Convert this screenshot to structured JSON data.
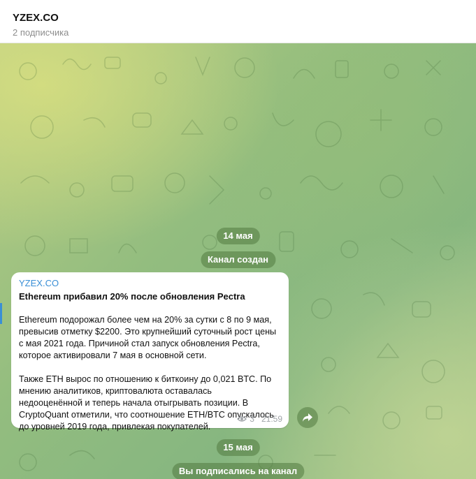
{
  "header": {
    "title": "YZEX.CO",
    "subtitle": "2 подписчика"
  },
  "chat": {
    "date_1": "14 мая",
    "service_1": "Канал создан",
    "message": {
      "author": "YZEX.CO",
      "headline": "Ethereum прибавил 20% после обновления Pectra",
      "para_1": "Ethereum подорожал более чем на 20% за сутки с 8 по 9 мая,\nпревысив отметку $2200. Это крупнейший суточный рост цены\nс мая 2021 года. Причиной стал запуск обновления Pectra,\nкоторое активировали 7 мая в основной сети.",
      "para_2": "Также ETH вырос по отношению к биткоину до 0,021 BTC. По\nмнению аналитиков, криптовалюта оставалась\nнедооценённой и теперь начала отыгрывать позиции. В\nCryptoQuant отметили, что соотношение ETH/BTC опускалось\nдо уровней 2019 года, привлекая покупателей.",
      "views": "3",
      "time": "21:59",
      "eye_icon": "eye-icon",
      "share_icon": "share-icon"
    },
    "date_2": "15 мая",
    "service_2": "Вы подписались на канал"
  },
  "colors": {
    "accent": "#3a8fd6",
    "service_bg": "rgba(82,122,64,0.55)",
    "bubble_bg": "#ffffff"
  }
}
